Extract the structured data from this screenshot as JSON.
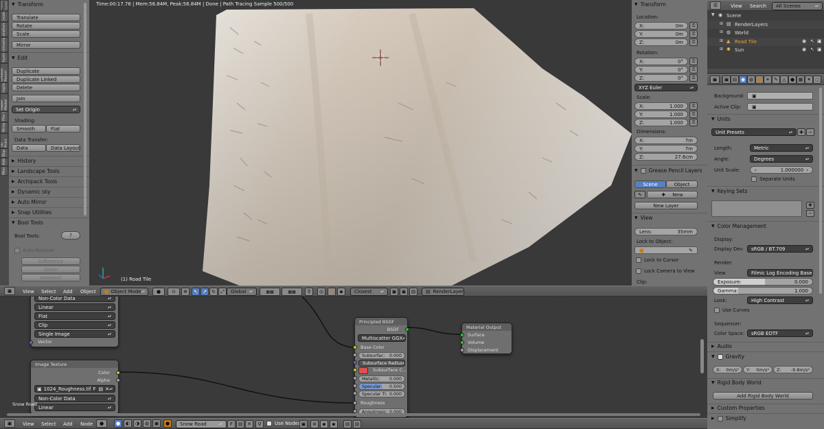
{
  "viewport": {
    "status": "Time:00:17.76 | Mem:56.84M, Peak:56.84M | Done | Path Tracing Sample 500/500",
    "object_label": "(1) Road Tile"
  },
  "tool_tabs": [
    "Tools",
    "Create",
    "Relations",
    "Animation",
    "Physics",
    "Grease Pencil",
    "Display",
    "Paper Model",
    "File I",
    "Mirror",
    "3D Print",
    "Bsp",
    "Add",
    "Misc"
  ],
  "tools": {
    "transform_header": "Transform",
    "translate": "Translate",
    "rotate": "Rotate",
    "scale": "Scale",
    "mirror": "Mirror",
    "edit_header": "Edit",
    "duplicate": "Duplicate",
    "duplicate_linked": "Duplicate Linked",
    "delete": "Delete",
    "join": "Join",
    "set_origin": "Set Origin",
    "shading_label": "Shading:",
    "smooth": "Smooth",
    "flat": "Flat",
    "data_transfer_label": "Data Transfer:",
    "data": "Data",
    "data_layout": "Data Layout",
    "history": "History",
    "landscape": "Landscape Tools",
    "archipack": "Archipack Tools",
    "dynamic_sky": "Dynamic sky",
    "auto_mirror": "Auto Mirror",
    "snap": "Snap Utilities",
    "bool_tools_header": "Bool Tools",
    "bool_tools_label": "Bool Tools:",
    "help": "?",
    "auto_boolean": "Auto Boolean",
    "difference": "Difference",
    "union": "Union",
    "intersect": "Intersect"
  },
  "properties": {
    "transform_header": "Transform",
    "location_label": "Location:",
    "location": [
      {
        "k": "X:",
        "v": "0m"
      },
      {
        "k": "Y:",
        "v": "0m"
      },
      {
        "k": "Z:",
        "v": "0m"
      }
    ],
    "rotation_label": "Rotation:",
    "rotation": [
      {
        "k": "X:",
        "v": "0°"
      },
      {
        "k": "Y:",
        "v": "0°"
      },
      {
        "k": "Z:",
        "v": "0°"
      }
    ],
    "rotation_mode": "XYZ Euler",
    "scale_label": "Scale:",
    "scale": [
      {
        "k": "X:",
        "v": "1.000"
      },
      {
        "k": "Y:",
        "v": "1.000"
      },
      {
        "k": "Z:",
        "v": "1.000"
      }
    ],
    "dimensions_label": "Dimensions:",
    "dimensions": [
      {
        "k": "X:",
        "v": "7m"
      },
      {
        "k": "Y:",
        "v": "7m"
      },
      {
        "k": "Z:",
        "v": "27.6cm"
      }
    ],
    "grease_header": "Grease Pencil Layers",
    "scene_tab": "Scene",
    "object_tab": "Object",
    "new": "New",
    "new_layer": "New Layer",
    "view_header": "View",
    "lens_label": "Lens:",
    "lens_value": "35mm",
    "lock_object_label": "Lock to Object:",
    "lock_cursor": "Lock to Cursor",
    "lock_camera": "Lock Camera to View",
    "clip_label": "Clip:"
  },
  "viewport_header": {
    "view": "View",
    "select": "Select",
    "add": "Add",
    "object": "Object",
    "mode": "Object Mode",
    "pivot": "Global",
    "snap": "Closest",
    "render_layer": "RenderLayer"
  },
  "outliner": {
    "view": "View",
    "search": "Search",
    "filter": "All Scenes",
    "items": [
      {
        "label": "Scene",
        "indent": 0
      },
      {
        "label": "RenderLayers",
        "indent": 1
      },
      {
        "label": "World",
        "indent": 1
      },
      {
        "label": "Road Tile",
        "indent": 1
      },
      {
        "label": "Sun",
        "indent": 1
      }
    ]
  },
  "scene_props": {
    "background_label": "Background:",
    "active_clip_label": "Active Clip:",
    "units_header": "Units",
    "unit_presets": "Unit Presets",
    "length_label": "Length:",
    "length_value": "Metric",
    "angle_label": "Angle:",
    "angle_value": "Degrees",
    "unit_scale_label": "Unit Scale:",
    "unit_scale_value": "1.000000",
    "separate_units": "Separate Units",
    "keying_header": "Keying Sets",
    "color_header": "Color Management",
    "display_label": "Display:",
    "display_dev_label": "Display Dev",
    "display_dev_value": "sRGB / BT.709",
    "render_label": "Render:",
    "view_label": "View",
    "view_value": "Filmic Log Encoding Base",
    "exposure_label": "Exposure:",
    "exposure_value": "0.000",
    "gamma_label": "Gamma:",
    "gamma_value": "1.000",
    "look_label": "Look:",
    "look_value": "High Contrast",
    "use_curves": "Use Curves",
    "sequencer_label": "Sequencer:",
    "color_space_label": "Color Space:",
    "color_space_value": "sRGB EOTF",
    "audio_header": "Audio",
    "gravity_header": "Gravity",
    "gravity": [
      {
        "k": "X:",
        "v": "0m/s²"
      },
      {
        "k": "Y:",
        "v": "0m/s²"
      },
      {
        "k": "Z:",
        "v": "-9.8m/s²"
      }
    ],
    "rigid_header": "Rigid Body World",
    "add_rigid": "Add Rigid Body World",
    "custom_props": "Custom Properties",
    "simplify": "Simplify"
  },
  "nodes": {
    "top_node_rows": [
      "Non-Color Data",
      "Linear",
      "Flat",
      "Clip",
      "Single Image"
    ],
    "top_node_vector": "Vector",
    "image_texture_title": "Image Texture",
    "image_color": "Color",
    "image_alpha": "Alpha",
    "image_file": "1024_Roughness.tif",
    "image_file_f": "F",
    "image_rows": [
      "Non-Color Data",
      "Linear"
    ],
    "bsdf_title": "Principled BSDF",
    "bsdf_out": "BSDF",
    "bsdf_dist": "Multiscatter GGX",
    "base_color": "Base Color",
    "subsurface_label": "Subsurfac:",
    "subsurface_value": "0.000",
    "subsurface_radius": "Subsurface Radius",
    "subsurface_color": "Subsurface C...",
    "metallic_label": "Metallic:",
    "metallic_value": "0.000",
    "specular_label": "Specular:",
    "specular_value": "0.500",
    "specular_tint_label": "Specular Ti:",
    "specular_tint_value": "0.000",
    "roughness": "Roughness",
    "anisotropic_label": "Anisotropic:",
    "anisotropic_value": "0.000",
    "output_title": "Material Output",
    "out_surface": "Surface",
    "out_volume": "Volume",
    "out_displacement": "Displacement",
    "material_name": "Snow Road"
  },
  "node_header": {
    "view": "View",
    "select": "Select",
    "add": "Add",
    "node": "Node",
    "material": "Snow Road",
    "f": "F",
    "use_nodes": "Use Nodes"
  },
  "colors": {
    "accent": "#5680c2",
    "subsurface_swatch": "#e05050",
    "terrain": "#d9d3cc"
  }
}
